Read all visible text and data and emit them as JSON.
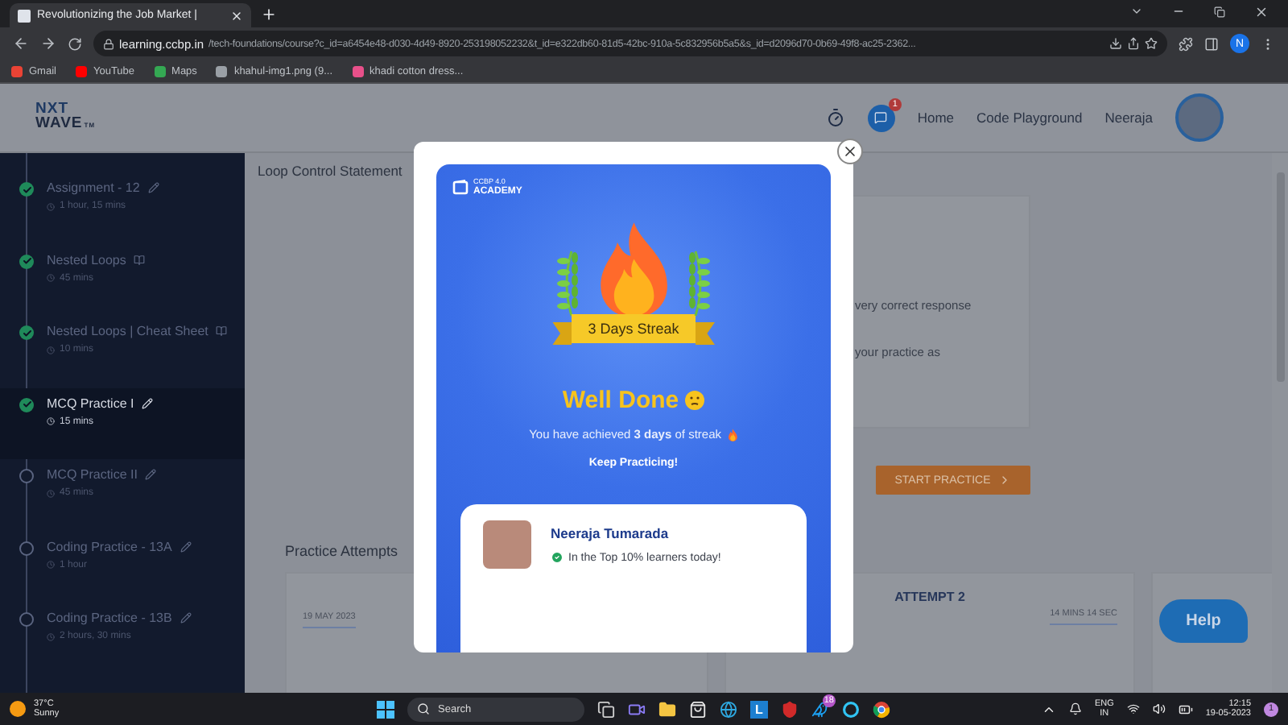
{
  "browser": {
    "tab": {
      "title": "Revolutionizing the Job Market |",
      "selected": true
    },
    "url": {
      "host": "learning.ccbp.in",
      "path": "/tech-foundations/course?c_id=a6454e48-d030-4d49-8920-253198052232&t_id=e322db60-81d5-42bc-910a-5c832956b5a5&s_id=d2096d70-0b69-49f8-ac25-2362..."
    },
    "profile": "N",
    "bookmarks": [
      {
        "label": "Gmail",
        "color": "#ea4335"
      },
      {
        "label": "YouTube",
        "color": "#ff0000"
      },
      {
        "label": "Maps",
        "color": "#34a853"
      },
      {
        "label": "khahul-img1.png (9...",
        "color": "#9aa0a6"
      },
      {
        "label": "khadi cotton dress...",
        "color": "#e8508a"
      }
    ]
  },
  "header": {
    "logo_top": "NXT",
    "logo_bottom": "WAVE",
    "logo_mark": "TM",
    "chat_badge": "1",
    "nav": [
      "Home",
      "Code Playground"
    ],
    "user": "Neeraja"
  },
  "sidebar": {
    "items": [
      {
        "title": "Assignment - 12",
        "duration": "1 hour, 15 mins",
        "kind": "assignment",
        "done": true,
        "selected": false
      },
      {
        "title": "Nested Loops",
        "duration": "45 mins",
        "kind": "reading",
        "done": true,
        "selected": false
      },
      {
        "title": "Nested Loops | Cheat Sheet",
        "duration": "10 mins",
        "kind": "reading",
        "done": true,
        "selected": false
      },
      {
        "title": "MCQ Practice I",
        "duration": "15 mins",
        "kind": "assignment",
        "done": true,
        "selected": true
      },
      {
        "title": "MCQ Practice II",
        "duration": "45 mins",
        "kind": "assignment",
        "done": false,
        "selected": false
      },
      {
        "title": "Coding Practice - 13A",
        "duration": "1 hour",
        "kind": "assignment",
        "done": false,
        "selected": false
      },
      {
        "title": "Coding Practice - 13B",
        "duration": "2 hours, 30 mins",
        "kind": "assignment",
        "done": false,
        "selected": false
      }
    ]
  },
  "content": {
    "breadcrumb": "Loop Control Statement",
    "card_lines": [
      "very correct response",
      "your practice as"
    ],
    "start_button": "START PRACTICE",
    "attempts_title": "Practice Attempts",
    "attempts": [
      {
        "date": "19 MAY 2023"
      },
      {
        "title": "ATTEMPT 2",
        "time": "14 MINS 14 SEC"
      }
    ]
  },
  "help": "Help",
  "modal": {
    "brand_top": "CCBP 4.0",
    "brand_bottom": "ACADEMY",
    "ribbon": "3 Days Streak",
    "heading": "Well Done",
    "message": "You have achieved **3 days** of streak",
    "cta": "Keep Practicing!",
    "learner": {
      "name": "Neeraja Tumarada",
      "badge": "In the Top 10% learners today!"
    }
  },
  "taskbar": {
    "weather": {
      "temp": "37°C",
      "condition": "Sunny"
    },
    "search": "Search",
    "tile_letter": "L",
    "twitter_badge": "18",
    "language": [
      "ENG",
      "IN"
    ],
    "time": "12:15",
    "date": "19-05-2023",
    "notification_badge": "1"
  }
}
